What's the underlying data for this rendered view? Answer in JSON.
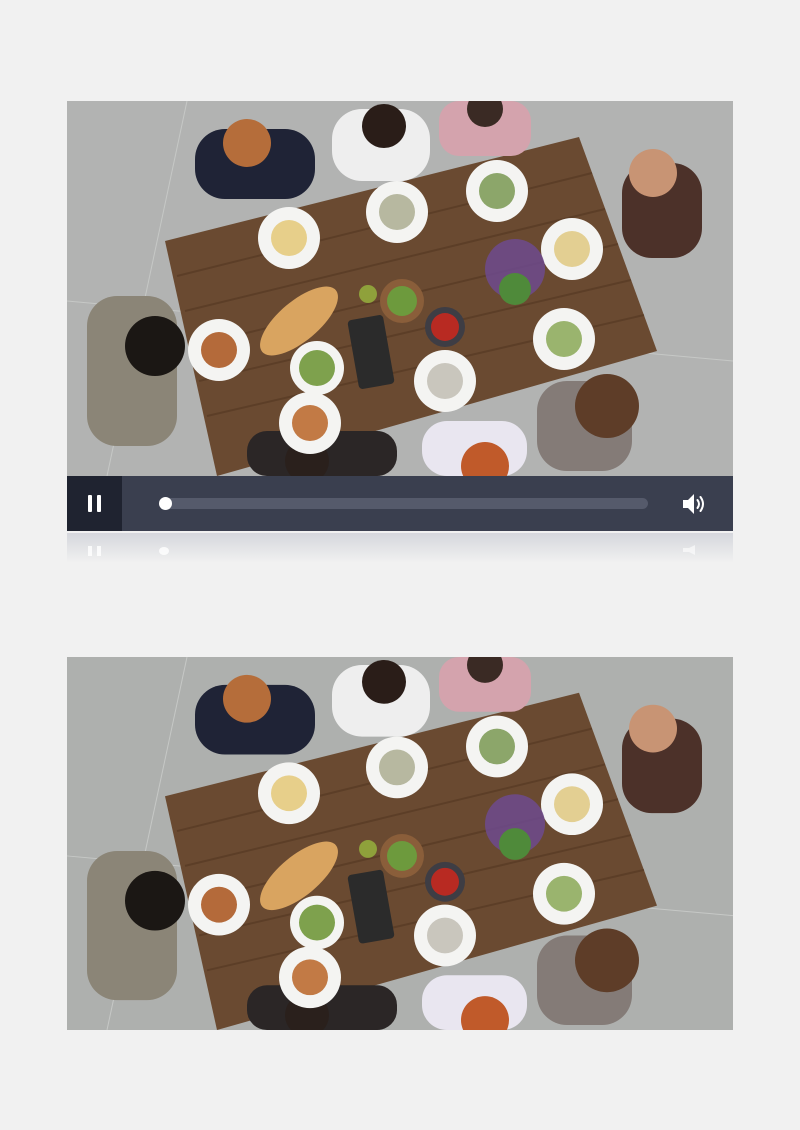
{
  "player": {
    "state": "playing",
    "progress": 0.0,
    "controls": {
      "play_pause_icon": "pause-icon",
      "volume_icon": "volume-icon"
    },
    "colors": {
      "control_bar": "#3a3f4f",
      "button_bg": "#1f2330",
      "track": "#555a6b",
      "thumb": "#ffffff"
    }
  },
  "video_frames": [
    {
      "scene": "overhead-dinner-table"
    },
    {
      "scene": "overhead-dinner-table"
    }
  ]
}
